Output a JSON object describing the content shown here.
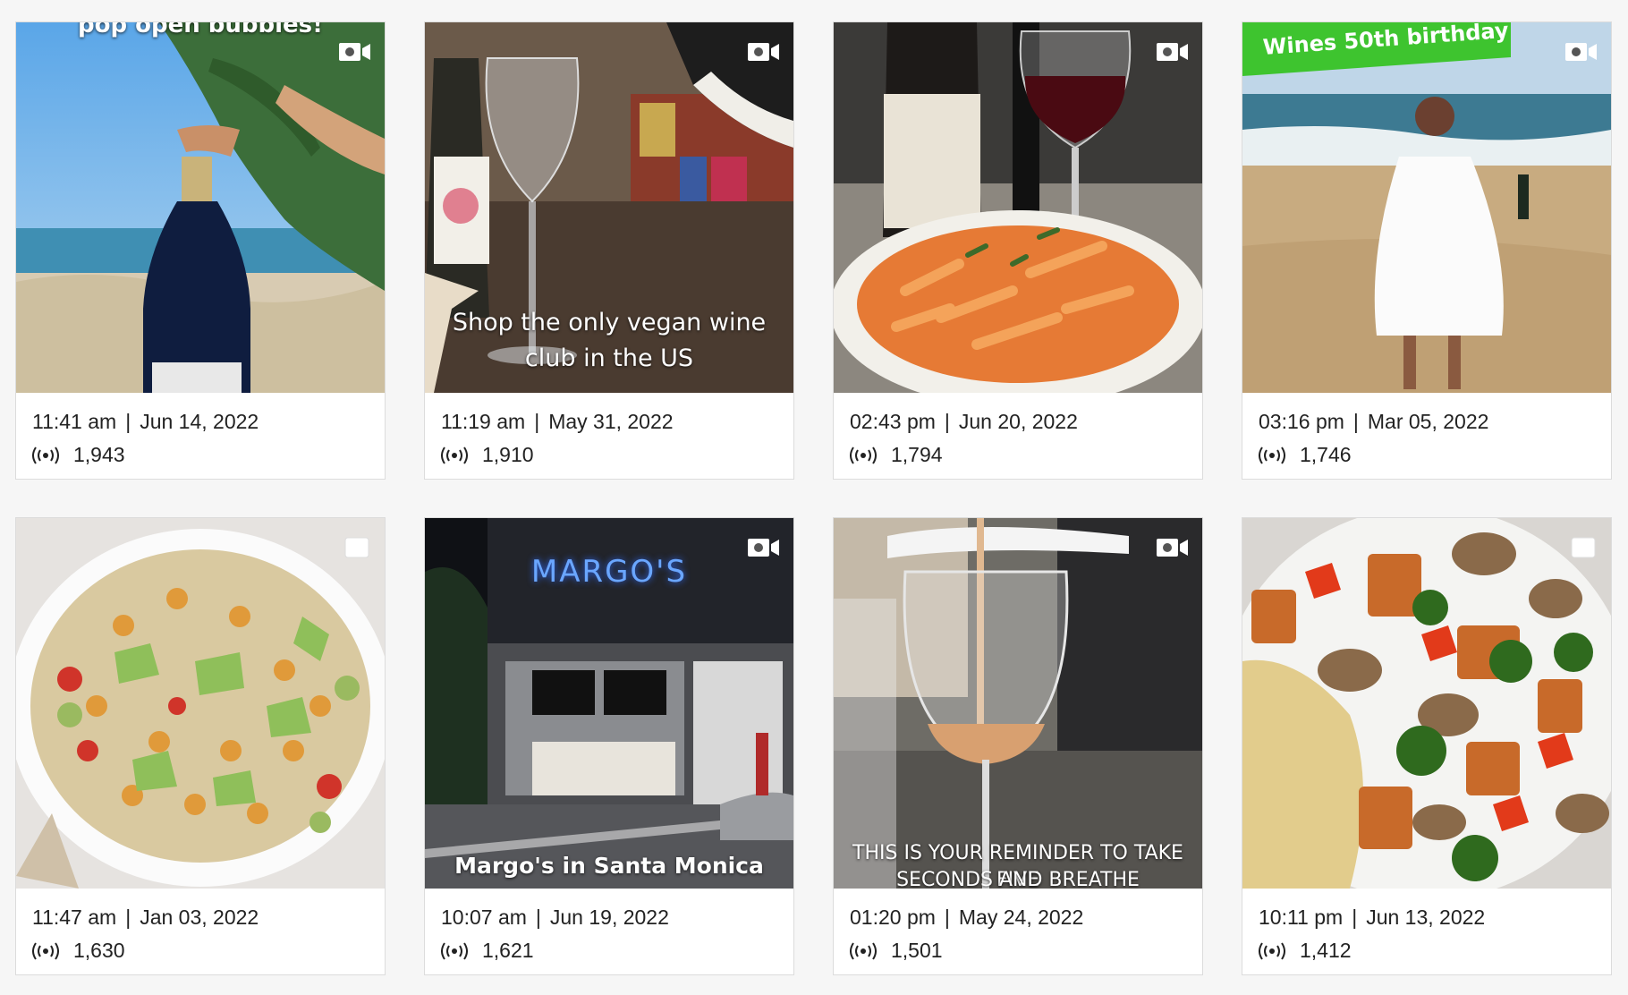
{
  "posts": [
    {
      "time": "11:41 am",
      "date": "Jun 14, 2022",
      "views": "1,943",
      "caption": "pop open bubbles!",
      "media_type": "video-icon",
      "image": "champagne bottle on tropical beach"
    },
    {
      "time": "11:19 am",
      "date": "May 31, 2022",
      "views": "1,910",
      "caption_line1": "Shop the only vegan wine",
      "caption_line2": "club in the US",
      "media_type": "video-icon",
      "image": "wine being poured into glass"
    },
    {
      "time": "02:43 pm",
      "date": "Jun 20, 2022",
      "views": "1,794",
      "media_type": "video-icon",
      "image": "penne pasta with red wine bottle"
    },
    {
      "time": "03:16 pm",
      "date": "Mar 05, 2022",
      "views": "1,746",
      "banner": "Wines 50th birthday",
      "media_type": "video-icon",
      "image": "woman in white dress on beach with champagne"
    },
    {
      "time": "11:47 am",
      "date": "Jan 03, 2022",
      "views": "1,630",
      "media_type": "image-icon",
      "image": "chickpea quinoa salad bowl"
    },
    {
      "time": "10:07 am",
      "date": "Jun 19, 2022",
      "views": "1,621",
      "sign": "MARGO'S",
      "caption": "Margo's in Santa Monica",
      "media_type": "video-icon",
      "image": "restaurant storefront at night"
    },
    {
      "time": "01:20 pm",
      "date": "May 24, 2022",
      "views": "1,501",
      "caption_line1": "THIS IS YOUR REMINDER TO TAKE FIVE",
      "caption_line2": "SECONDS AND BREATHE",
      "media_type": "video-icon",
      "image": "rose wine pouring into glass"
    },
    {
      "time": "10:11 pm",
      "date": "Jun 13, 2022",
      "views": "1,412",
      "media_type": "image-icon",
      "image": "tofu vegetable stir fry with rice"
    }
  ],
  "separator": "|"
}
